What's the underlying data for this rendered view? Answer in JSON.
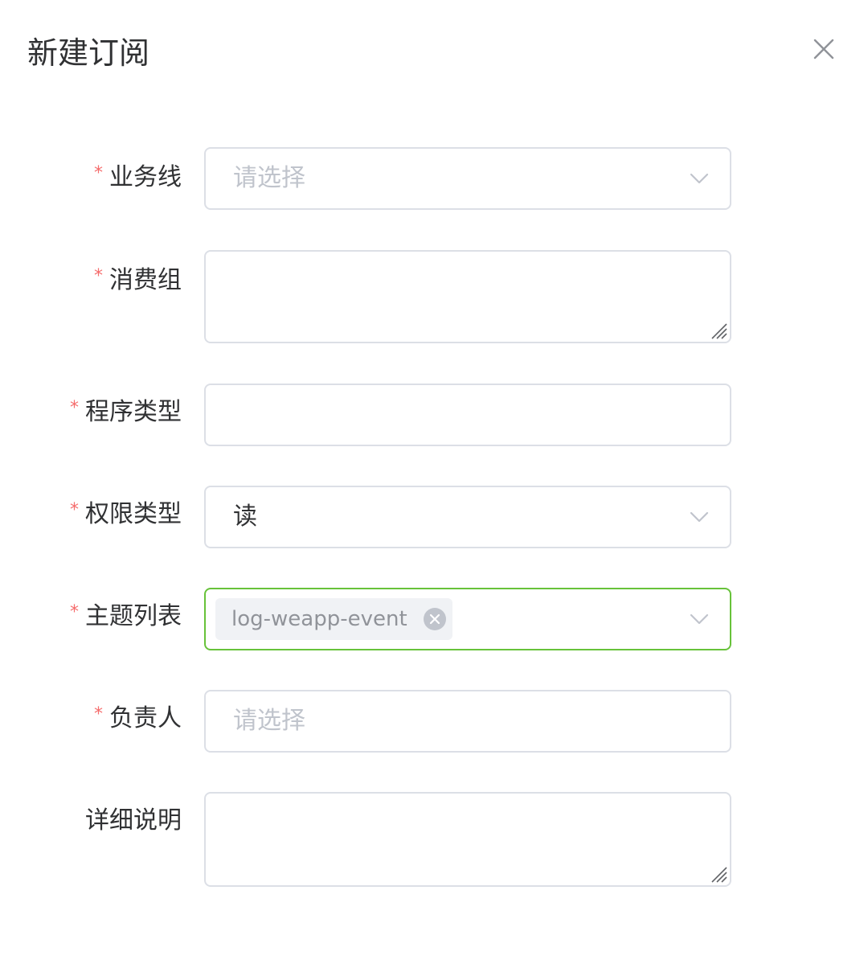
{
  "dialog": {
    "title": "新建订阅",
    "close_icon": "close-icon"
  },
  "form": {
    "business_line": {
      "label": "业务线",
      "required": "*",
      "placeholder": "请选择",
      "icon": "chevron-down-icon"
    },
    "consumer_group": {
      "label": "消费组",
      "required": "*",
      "value": ""
    },
    "program_type": {
      "label": "程序类型",
      "required": "*",
      "value": ""
    },
    "permission_type": {
      "label": "权限类型",
      "required": "*",
      "value": "读",
      "icon": "chevron-down-icon"
    },
    "topic_list": {
      "label": "主题列表",
      "required": "*",
      "tags": [
        "log-weapp-event"
      ],
      "icon": "chevron-down-icon"
    },
    "owner": {
      "label": "负责人",
      "required": "*",
      "placeholder": "请选择"
    },
    "description": {
      "label": "详细说明",
      "value": ""
    }
  },
  "colors": {
    "required_star": "#f56c6c",
    "focus_border": "#67c23a",
    "border": "#dcdfe6",
    "placeholder": "#c0c4cc"
  }
}
